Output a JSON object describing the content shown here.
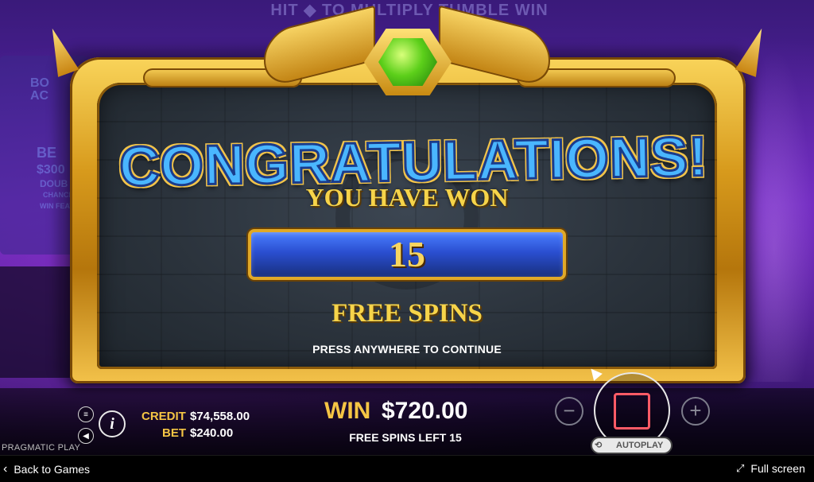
{
  "game": {
    "top_banner": "HIT ◆ TO MULTIPLY TUMBLE WIN",
    "left_panel_lines": [
      "BO",
      "AC",
      "BE",
      "$300",
      "DOUB",
      "CHANCE",
      "WIN FEAT"
    ]
  },
  "popup": {
    "title": "CONGRATULATIONS!",
    "you_have_won": "YOU HAVE WON",
    "spins_awarded": "15",
    "free_spins_label": "FREE SPINS",
    "continue_hint": "PRESS ANYWHERE TO CONTINUE",
    "gem_color": "#5ccf1a"
  },
  "hud": {
    "credit_label": "CREDIT",
    "credit_value": "$74,558.00",
    "bet_label": "BET",
    "bet_value": "$240.00",
    "win_label": "WIN",
    "win_value": "$720.00",
    "free_spins_left": "FREE SPINS LEFT 15",
    "decrease_symbol": "−",
    "increase_symbol": "+",
    "autoplay_label": "AUTOPLAY",
    "provider": "PRAGMATIC PLAY",
    "accent_color": "#f5c544",
    "spin_color": "#ff5b66"
  },
  "bottom_bar": {
    "back_label": "Back to Games",
    "fullscreen_label": "Full screen"
  }
}
